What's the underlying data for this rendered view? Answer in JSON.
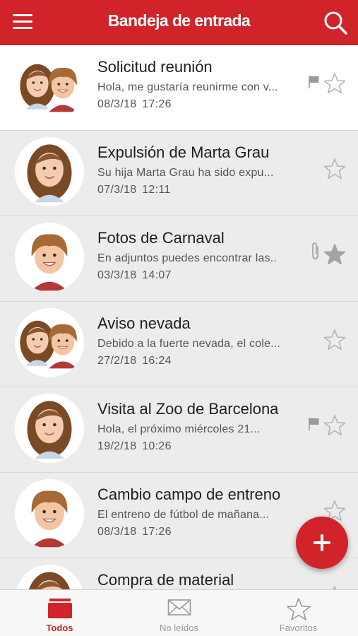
{
  "header": {
    "title": "Bandeja de entrada",
    "menu_icon": "hamburger-menu-icon",
    "search_icon": "search-icon",
    "background_color": "#d1232a"
  },
  "messages": [
    {
      "subject": "Solicitud reunión",
      "preview": "Hola, me gustaría reunirme con v...",
      "date": "08/3/18  17:26",
      "avatar": "two-children",
      "unread": true,
      "flagged": true,
      "attachment": false,
      "starred": false
    },
    {
      "subject": "Expulsión de Marta Grau",
      "preview": "Su hija Marta Grau ha sido expu...",
      "date": "07/3/18  12:11",
      "avatar": "girl",
      "unread": false,
      "flagged": false,
      "attachment": false,
      "starred": false
    },
    {
      "subject": "Fotos de Carnaval",
      "preview": "En adjuntos puedes encontrar las..",
      "date": "03/3/18  14:07",
      "avatar": "boy",
      "unread": false,
      "flagged": false,
      "attachment": true,
      "starred": true
    },
    {
      "subject": "Aviso nevada",
      "preview": "Debido a la fuerte nevada, el cole...",
      "date": "27/2/18  16:24",
      "avatar": "two-children",
      "unread": false,
      "flagged": false,
      "attachment": false,
      "starred": false
    },
    {
      "subject": "Visita al Zoo de Barcelona",
      "preview": "Hola, el próximo miércoles 21...",
      "date": "19/2/18  10:26",
      "avatar": "girl",
      "unread": false,
      "flagged": true,
      "attachment": false,
      "starred": false
    },
    {
      "subject": "Cambio campo de entreno",
      "preview": "El entreno de fútbol de mañana...",
      "date": "08/3/18  17:26",
      "avatar": "boy",
      "unread": false,
      "flagged": false,
      "attachment": false,
      "starred": false
    },
    {
      "subject": "Compra de material",
      "preview": "",
      "date": "",
      "avatar": "girl",
      "unread": false,
      "flagged": false,
      "attachment": false,
      "starred": false
    }
  ],
  "fab": {
    "icon": "plus-icon",
    "color": "#d1232a"
  },
  "tabs": [
    {
      "label": "Todos",
      "icon": "inbox-tray-icon",
      "active": true
    },
    {
      "label": "No leídos",
      "icon": "envelope-icon",
      "active": false
    },
    {
      "label": "Favoritos",
      "icon": "star-icon",
      "active": false
    }
  ],
  "colors": {
    "accent": "#d1232a",
    "read_row_bg": "#ececec",
    "unread_row_bg": "#ffffff",
    "star_outline": "#b4b4b4",
    "star_filled": "#a3a3a3"
  }
}
